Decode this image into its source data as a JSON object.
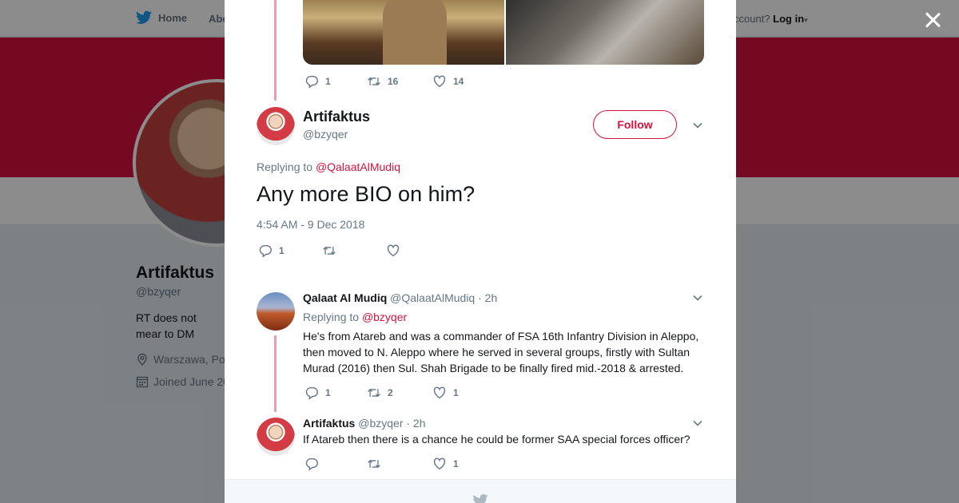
{
  "nav": {
    "home_label": "Home",
    "about_label": "Abo",
    "account_prompt": "ccount?",
    "login_label": "Log in"
  },
  "profile": {
    "name": "Artifaktus",
    "handle": "@bzyqer",
    "bio": "RT does not mear to DM",
    "location": "Warszawa, Po",
    "joined": "Joined June 20"
  },
  "prev_tweet": {
    "reply_count": "1",
    "retweet_count": "16",
    "like_count": "14"
  },
  "main_tweet": {
    "name": "Artifaktus",
    "handle": "@bzyqer",
    "follow_label": "Follow",
    "replying_prefix": "Replying to",
    "replying_to": "@QalaatAlMudiq",
    "text": "Any more BIO on him?",
    "timestamp": "4:54 AM - 9 Dec 2018",
    "reply_count": "1"
  },
  "replies": [
    {
      "name": "Qalaat Al Mudiq",
      "handle": "@QalaatAlMudiq",
      "time": "· 2h",
      "replying_prefix": "Replying to",
      "replying_to": "@bzyqer",
      "text": "He's from Atareb and was a commander of FSA 16th Infantry Division in Aleppo, then moved to N. Aleppo where he served in several groups, firstly with Sultan Murad (2016) then Sul. Shah Brigade to be finally fired mid.-2018 & arrested.",
      "reply_count": "1",
      "retweet_count": "2",
      "like_count": "1"
    },
    {
      "name": "Artifaktus",
      "handle": "@bzyqer",
      "time": "· 2h",
      "text": "If Atareb then there is a chance he could be former SAA special forces officer?",
      "like_count": "1"
    }
  ],
  "colors": {
    "accent": "#d5123f",
    "thread_line": "#f09aac",
    "muted": "#657786"
  }
}
